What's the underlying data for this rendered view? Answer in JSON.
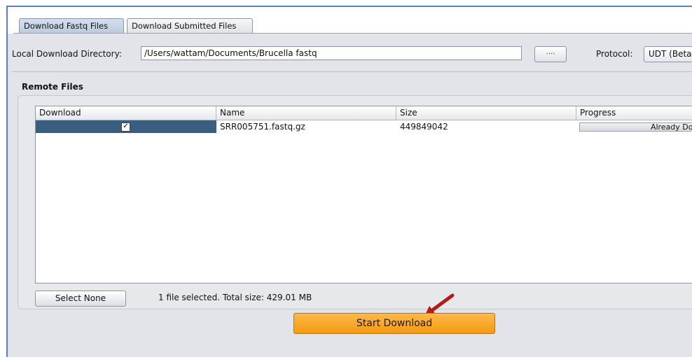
{
  "tabs": [
    {
      "label": "Download Fastq Files",
      "active": true
    },
    {
      "label": "Download Submitted Files",
      "active": false
    }
  ],
  "directory": {
    "label": "Local Download Directory:",
    "value": "/Users/wattam/Documents/Brucella fastq",
    "browse_label": "...."
  },
  "protocol": {
    "label": "Protocol:",
    "selected": "UDT (Beta"
  },
  "remote_files": {
    "title": "Remote Files",
    "columns": [
      "Download",
      "Name",
      "Size",
      "Progress"
    ],
    "rows": [
      {
        "download_checked": true,
        "checkmark": "✓",
        "name": "SRR005751.fastq.gz",
        "size": "449849042",
        "progress": "Already Downloa"
      }
    ]
  },
  "selection": {
    "select_none_label": "Select None",
    "status": "1 file selected. Total size: 429.01 MB"
  },
  "start_download_label": "Start Download",
  "colors": {
    "frame_border": "#5a80bf",
    "selected_row": "#3b5d80",
    "start_button": "#f59a12",
    "arrow": "#b01c16"
  }
}
